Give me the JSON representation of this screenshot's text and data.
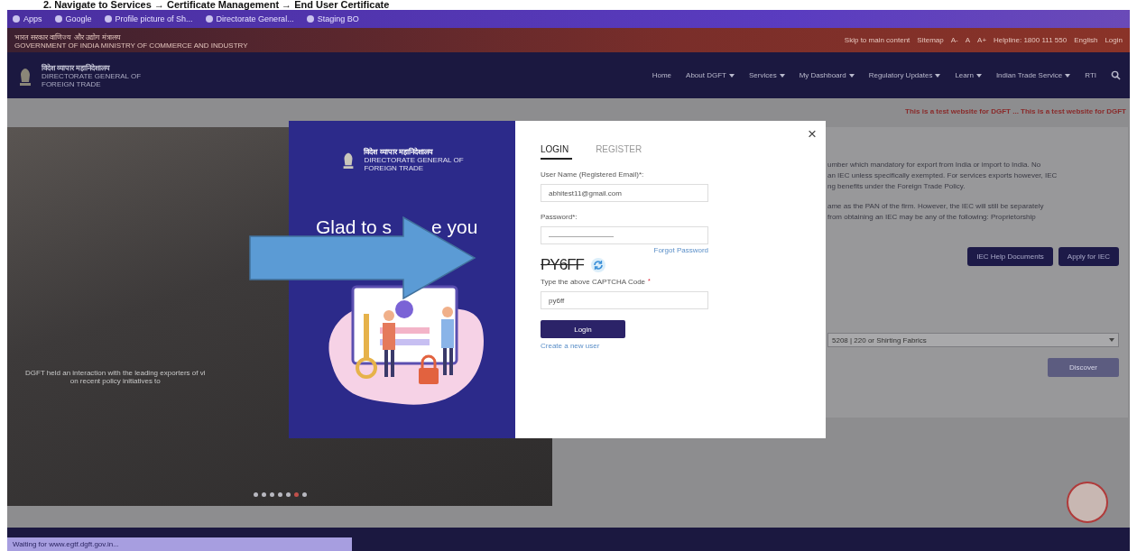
{
  "heading": "2.   Navigate to Services → Certificate Management → End User Certificate",
  "bookmarks": [
    {
      "label": "Apps"
    },
    {
      "label": "Google"
    },
    {
      "label": "Profile picture of Sh..."
    },
    {
      "label": "Directorate General..."
    },
    {
      "label": "Staging BO"
    }
  ],
  "gov_bar": {
    "left": [
      "भारत सरकार  वाणिज्य और उद्योग मंत्रालय",
      "GOVERNMENT OF INDIA  MINISTRY OF COMMERCE AND INDUSTRY"
    ],
    "links": [
      "Skip to main content",
      "Sitemap",
      "A-",
      "A",
      "A+",
      "Helpline: 1800 111 550",
      "English",
      "Login"
    ]
  },
  "site": {
    "name_hindi": "विदेश व्यापार महानिदेशालय",
    "name_lines": [
      "DIRECTORATE GENERAL OF",
      "FOREIGN TRADE"
    ]
  },
  "nav": [
    {
      "label": "Home",
      "dropdown": false
    },
    {
      "label": "About DGFT",
      "dropdown": true
    },
    {
      "label": "Services",
      "dropdown": true
    },
    {
      "label": "My Dashboard",
      "dropdown": true
    },
    {
      "label": "Regulatory Updates",
      "dropdown": true
    },
    {
      "label": "Learn",
      "dropdown": true
    },
    {
      "label": "Indian Trade Service",
      "dropdown": true
    },
    {
      "label": "RTI",
      "dropdown": false
    }
  ],
  "marquee": "This is a test website for DGFT ... This is a test website for DGFT",
  "carousel": {
    "caption": [
      "DGFT held an interaction with the leading exporters of vi",
      "on recent policy initiatives to"
    ],
    "dots": [
      {
        "selected": false
      },
      {
        "selected": false
      },
      {
        "selected": false
      },
      {
        "selected": false
      },
      {
        "selected": false
      },
      {
        "selected": true
      },
      {
        "selected": false
      }
    ]
  },
  "iec_panel": {
    "lines": [
      "umber which mandatory for export from India or import to India. No",
      "an IEC unless specifically exempted. For services exports however, IEC",
      "ng benefits under the Foreign Trade Policy.",
      "ame as the PAN of the firm. However, the IEC will still be separately",
      "from obtaining an IEC may be any of the following: Proprietorship"
    ],
    "buttons": [
      "IEC Help Documents",
      "Apply for IEC"
    ],
    "select_value": "5208 | 220 or Shirting Fabrics",
    "discover": "Discover"
  },
  "modal": {
    "site_hindi": "विदेश व्यापार महानिदेशालय",
    "site_lines": [
      "DIRECTORATE GENERAL OF",
      "FOREIGN TRADE"
    ],
    "greeting": [
      "Glad to s",
      "e you"
    ],
    "tabs": [
      {
        "label": "LOGIN",
        "selected": true
      },
      {
        "label": "REGISTER",
        "selected": false
      }
    ],
    "close": "×",
    "username_label": "User Name (Registered Email)*:",
    "username_value": "abhitest11@gmail.com",
    "password_label": "Password*:",
    "password_value": "—————————",
    "forgot": "Forgot Password",
    "captcha": "PY6FF",
    "captcha_label": "Type the above CAPTCHA Code",
    "required": "*",
    "captcha_value": "py6ff",
    "login": "Login",
    "create": "Create a new user"
  },
  "status": "Waiting for www.egtf.dgft.gov.in..."
}
